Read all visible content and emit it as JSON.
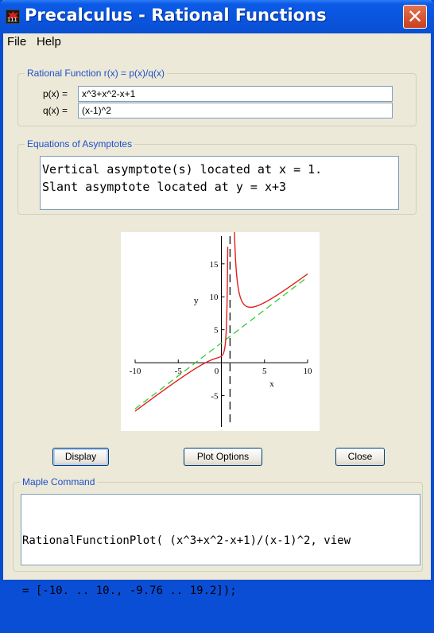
{
  "window": {
    "title": "Precalculus - Rational Functions",
    "close_glyph": "✕",
    "icon_digits": "111"
  },
  "menu": {
    "file": "File",
    "help": "Help"
  },
  "rational": {
    "legend": "Rational Function r(x) = p(x)/q(x)",
    "p_label": "p(x) =",
    "p_value": "x^3+x^2-x+1",
    "q_label": "q(x) =",
    "q_value": "(x-1)^2"
  },
  "asymptotes": {
    "legend": "Equations of Asymptotes",
    "line1": "Vertical asymptote(s) located at x = 1.",
    "line2": "Slant asymptote located at y = x+3"
  },
  "chart_data": {
    "type": "line",
    "xlabel": "x",
    "ylabel": "y",
    "xlim": [
      -10,
      10
    ],
    "ylim": [
      -9.76,
      19.2
    ],
    "x_ticks": [
      -10,
      -5,
      0,
      5,
      10
    ],
    "y_ticks": [
      -5,
      5,
      10,
      15
    ],
    "grid": false,
    "series": [
      {
        "function": "(x^3+x^2-x+1)/(x-1)^2",
        "color": "#e0201e",
        "style": "solid"
      },
      {
        "function": "x+3",
        "color": "#33cc33",
        "style": "dashed"
      },
      {
        "vertical_x": 1,
        "color": "#000000",
        "style": "dashed"
      }
    ],
    "tick_labels": {
      "x": [
        "-10",
        "-5",
        "0",
        "5",
        "10"
      ],
      "y": [
        "-5",
        "5",
        "10",
        "15"
      ]
    }
  },
  "buttons": {
    "display": "Display",
    "plot_options": "Plot Options",
    "close": "Close"
  },
  "maple": {
    "legend": "Maple Command",
    "line1": "RationalFunctionPlot( (x^3+x^2-x+1)/(x-1)^2, view",
    "line2": "= [-10. .. 10., -9.76 .. 19.2]);"
  }
}
